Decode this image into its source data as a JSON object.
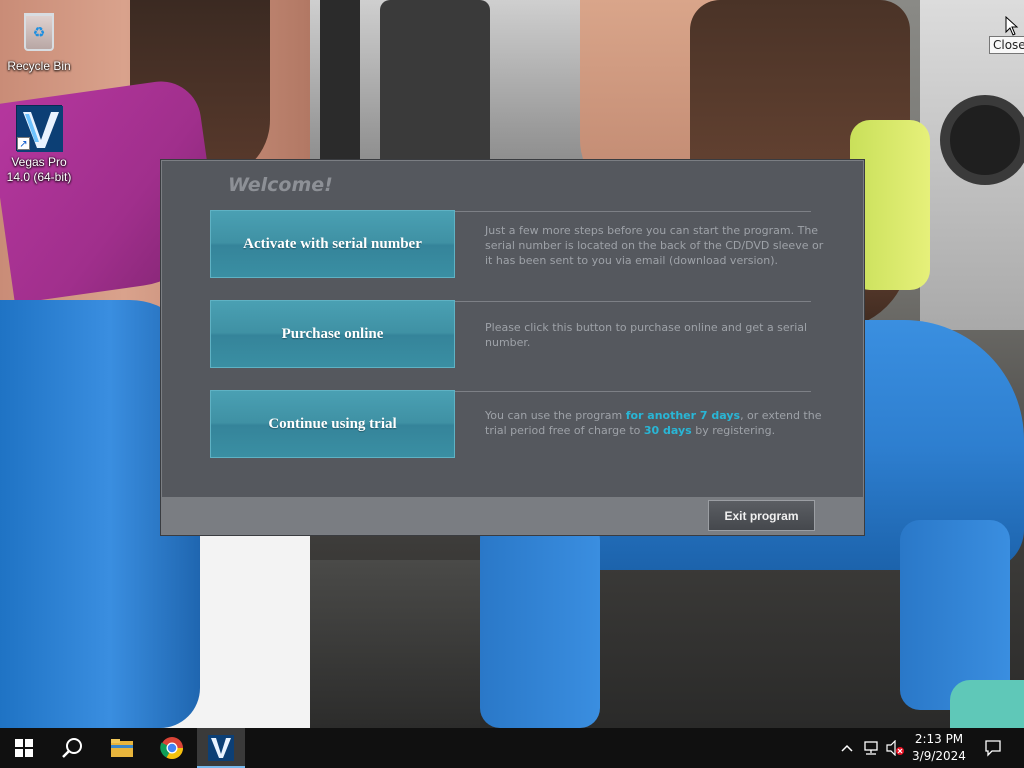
{
  "desktop": {
    "icons": [
      {
        "label": "Recycle Bin",
        "icon": "recycle-bin-icon"
      },
      {
        "label": "Vegas Pro 14.0 (64-bit)",
        "icon": "vegas-pro-icon"
      }
    ],
    "tooltip": "Close"
  },
  "dialog": {
    "title": "Welcome!",
    "options": [
      {
        "label": "Activate with serial number",
        "description": "Just a few more steps before you can start the program. The serial number is located on the back of the CD/DVD sleeve or it has been sent to you via email (download version)."
      },
      {
        "label": "Purchase online",
        "description": "Please click this button to purchase online and get a serial number."
      },
      {
        "label": "Continue using trial",
        "desc_part1": "You can use the program ",
        "desc_hl1": "for another 7 days",
        "desc_part2": ", or extend the trial period free of charge to ",
        "desc_hl2": "30 days",
        "desc_part3": " by registering."
      }
    ],
    "exit_label": "Exit program",
    "accent_color": "#3f91a4",
    "highlight_color": "#29b6d6"
  },
  "taskbar": {
    "items": [
      "start-icon",
      "search-icon",
      "file-explorer-icon",
      "chrome-icon",
      "vegas-pro-icon"
    ],
    "clock": {
      "time": "2:13 PM",
      "date": "3/9/2024"
    }
  }
}
